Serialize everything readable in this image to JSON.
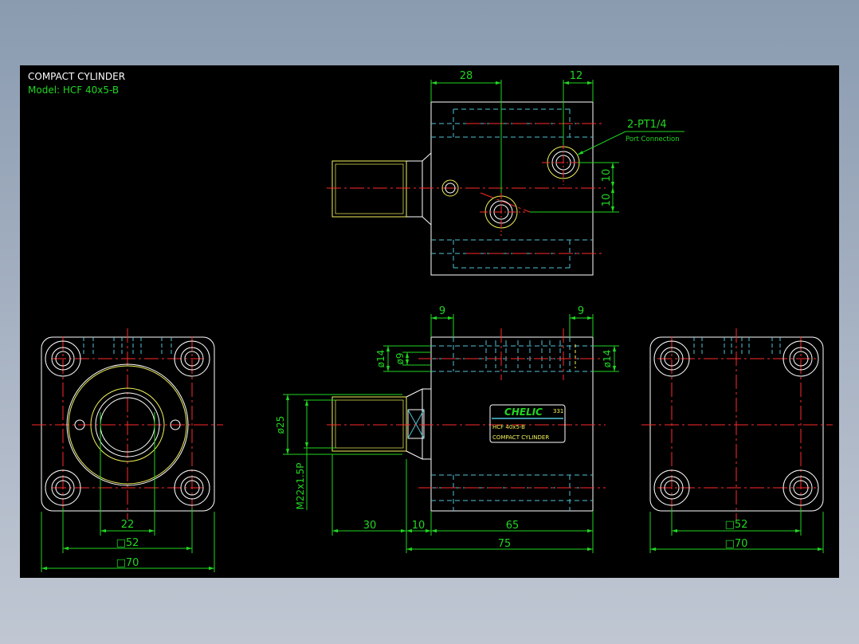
{
  "drawing": {
    "title": "COMPACT CYLINDER",
    "model": "Model:  HCF 40x5-B"
  },
  "dimensions": {
    "top_28": "28",
    "top_12": "12",
    "top_10a": "10",
    "top_10b": "10",
    "port_label": "2-PT1/4",
    "port_sub": "Port Connection",
    "front_9a": "9",
    "front_9b": "9",
    "dia14_left": "ø14",
    "dia9": "ø9",
    "dia14_right": "ø14",
    "dia25": "ø25",
    "thread": "M22x1.5P",
    "len_30": "30",
    "len_10": "10",
    "len_65": "65",
    "len_75": "75",
    "left_22": "22",
    "left_52": "□52",
    "left_70": "□70",
    "right_52": "□52",
    "right_70": "□70"
  },
  "label_plate": {
    "brand": "CHELIC",
    "code": "331",
    "model": "HCF 40x5-B",
    "name": "COMPACT CYLINDER"
  },
  "colors": {
    "outline": "#ffffff",
    "hidden": "#4fc3d9",
    "center": "#ff2a2a",
    "dimension": "#21d621",
    "yellow": "#f2f25a"
  }
}
